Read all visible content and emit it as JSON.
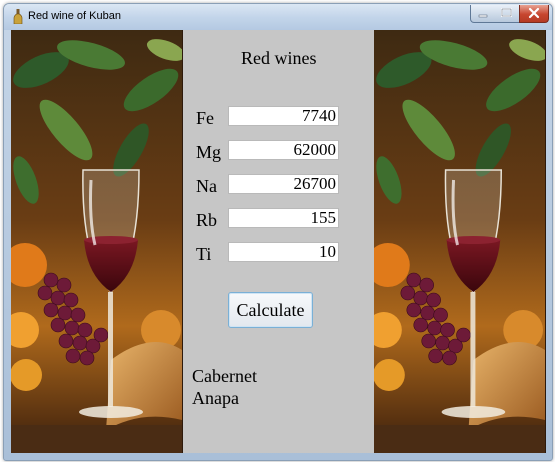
{
  "window": {
    "title": "Red wine of Kuban"
  },
  "form": {
    "heading": "Red wines",
    "fields": [
      {
        "label": "Fe",
        "value": "7740"
      },
      {
        "label": "Mg",
        "value": "62000"
      },
      {
        "label": "Na",
        "value": "26700"
      },
      {
        "label": "Rb",
        "value": "155"
      },
      {
        "label": "Ti",
        "value": "10"
      }
    ],
    "calculate_label": "Calculate",
    "result_lines": [
      "Cabernet",
      "Anapa"
    ]
  },
  "colors": {
    "panel_background": "#c6c6c6",
    "wine_red": "#5c0d16",
    "button_border": "#7ab0d6"
  },
  "icons": [
    "wine-bottle-icon",
    "minimize-icon",
    "maximize-icon",
    "close-icon"
  ]
}
